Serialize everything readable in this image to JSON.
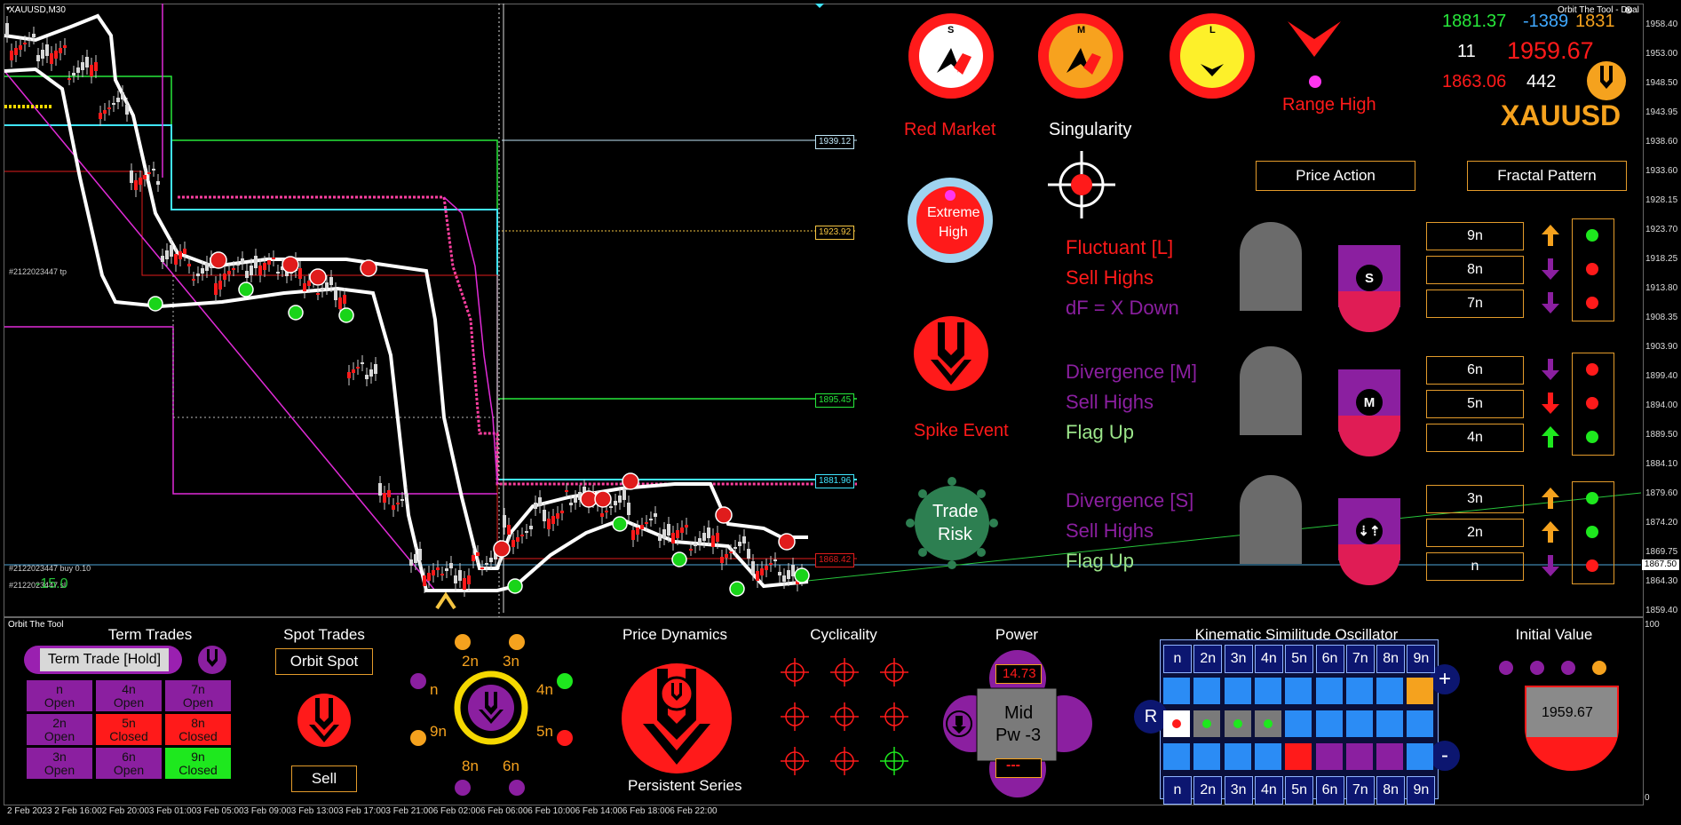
{
  "chart": {
    "symbol": "XAUUSD,M30",
    "indicator_title": "Orbit The Tool - Dual",
    "trade_label_1": "#2122023447 tp",
    "trade_label_2": "#2122023447 buy 0.10",
    "trade_label_3": "#2122023447 sl",
    "pnl": "-15.0",
    "price_axis": [
      "1958.40",
      "1953.00",
      "1948.50",
      "1943.95",
      "1938.60",
      "1933.60",
      "1928.15",
      "1923.70",
      "1918.25",
      "1913.80",
      "1908.35",
      "1903.90",
      "1899.40",
      "1894.00",
      "1889.50",
      "1884.10",
      "1879.60",
      "1874.20",
      "1869.75",
      "1864.30",
      "1859.40"
    ],
    "current_price": "1867.50",
    "level_tags": [
      {
        "value": "1939.12",
        "color": "#bfe6f7"
      },
      {
        "value": "1923.92",
        "color": "#f5c542"
      },
      {
        "value": "1895.45",
        "color": "#27e83b"
      },
      {
        "value": "1881.96",
        "color": "#40e6ff"
      },
      {
        "value": "1868.42",
        "color": "#e01c1c"
      }
    ],
    "time_axis": [
      "2 Feb 2023",
      "2 Feb 16:00",
      "2 Feb 20:00",
      "3 Feb 01:00",
      "3 Feb 05:00",
      "3 Feb 09:00",
      "3 Feb 13:00",
      "3 Feb 17:00",
      "3 Feb 21:00",
      "6 Feb 02:00",
      "6 Feb 06:00",
      "6 Feb 10:00",
      "6 Feb 14:00",
      "6 Feb 18:00",
      "6 Feb 22:00"
    ],
    "subwindow_title": "Orbit The Tool",
    "subwindow_axis_top": "100",
    "subwindow_axis_bottom": "0"
  },
  "dashboard": {
    "badges": [
      {
        "letter": "S",
        "label": ""
      },
      {
        "letter": "M",
        "label": ""
      },
      {
        "letter": "L",
        "label": ""
      }
    ],
    "range_high": "Range High",
    "red_market": "Red Market",
    "singularity": "Singularity",
    "extreme_high_line1": "Extreme",
    "extreme_high_line2": "High",
    "spike_event": "Spike Event",
    "trade_risk_line1": "Trade",
    "trade_risk_line2": "Risk",
    "stats": {
      "v1": "1881.37",
      "v2": "-1389",
      "v3": "1831",
      "v4": "11",
      "v5": "1959.67",
      "v6": "1863.06",
      "v7": "442"
    },
    "symbol": "XAUUSD",
    "price_action": "Price Action",
    "fractal_pattern": "Fractal Pattern",
    "groups": [
      {
        "l1": "Fluctuant [L]",
        "l2": "Sell Highs",
        "l3": "dF = X Down",
        "badge": "S"
      },
      {
        "l1": "Divergence [M]",
        "l2": "Sell Highs",
        "l3": "Flag Up",
        "badge": "M"
      },
      {
        "l1": "Divergence [S]",
        "l2": "Sell Highs",
        "l3": "Flag Up",
        "badge": "⇣⇡"
      }
    ],
    "fractals": [
      {
        "label": "9n",
        "arrow": "up",
        "dot": "green"
      },
      {
        "label": "8n",
        "arrow": "down",
        "dot": "red"
      },
      {
        "label": "7n",
        "arrow": "down",
        "dot": "red"
      },
      {
        "label": "6n",
        "arrow": "down",
        "dot": "red"
      },
      {
        "label": "5n",
        "arrow": "down-red",
        "dot": "red"
      },
      {
        "label": "4n",
        "arrow": "up-green",
        "dot": "green"
      },
      {
        "label": "3n",
        "arrow": "up",
        "dot": "green"
      },
      {
        "label": "2n",
        "arrow": "up",
        "dot": "green"
      },
      {
        "label": "n",
        "arrow": "down",
        "dot": "red"
      }
    ]
  },
  "bottom": {
    "term_trades": "Term Trades",
    "term_trade_hold": "Term Trade [Hold]",
    "term_cells": [
      {
        "t": "n\nOpen",
        "bg": "#8b1fa0"
      },
      {
        "t": "4n\nOpen",
        "bg": "#8b1fa0"
      },
      {
        "t": "7n\nOpen",
        "bg": "#8b1fa0"
      },
      {
        "t": "2n\nOpen",
        "bg": "#8b1fa0"
      },
      {
        "t": "5n\nClosed",
        "bg": "#ff1a1a"
      },
      {
        "t": "8n\nClosed",
        "bg": "#ff1a1a"
      },
      {
        "t": "3n\nOpen",
        "bg": "#8b1fa0"
      },
      {
        "t": "6n\nOpen",
        "bg": "#8b1fa0"
      },
      {
        "t": "9n\nClosed",
        "bg": "#1ee81e"
      }
    ],
    "spot_trades": "Spot Trades",
    "orbit_spot": "Orbit Spot",
    "sell": "Sell",
    "orbit_labels": [
      "2n",
      "3n",
      "n",
      "4n",
      "9n",
      "5n",
      "8n",
      "6n"
    ],
    "price_dynamics": "Price Dynamics",
    "persistent_series": "Persistent Series",
    "cyclicality": "Cyclicality",
    "power": "Power",
    "power_value": "14.73",
    "power_mid": "Mid",
    "power_pw": "Pw -3",
    "power_dash": "---",
    "kso_title": "Kinematic Similitude Oscillator",
    "kso_header": [
      "n",
      "2n",
      "3n",
      "4n",
      "5n",
      "6n",
      "7n",
      "8n",
      "9n"
    ],
    "kso_plus": "+",
    "kso_minus": "-",
    "kso_r": "R",
    "initial_value": "Initial Value",
    "initial_value_num": "1959.67"
  }
}
